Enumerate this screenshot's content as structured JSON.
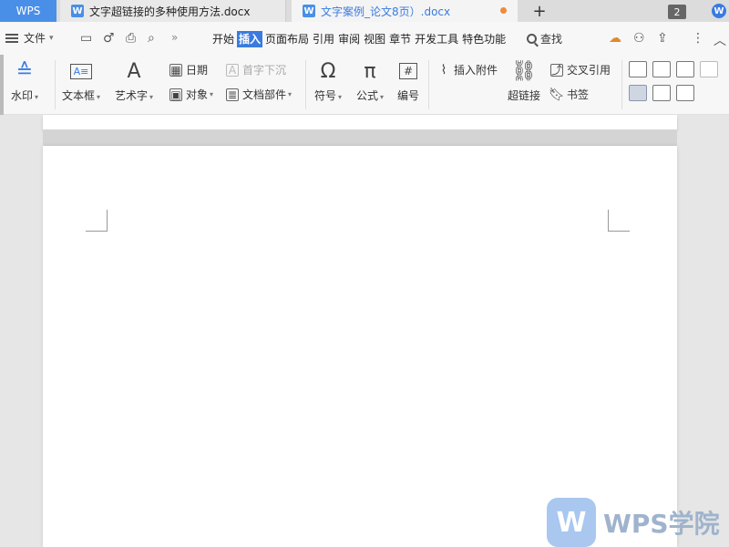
{
  "tabs": {
    "app_label": "WPS",
    "doc1_title": "文字超链接的多种使用方法.docx",
    "doc2_title": "文字案例_论文8页）.docx",
    "new_tab": "+",
    "window_count": "2"
  },
  "menu": {
    "file_label": "文件",
    "items": [
      "开始",
      "插入",
      "页面布局",
      "引用",
      "审阅",
      "视图",
      "章节",
      "开发工具",
      "特色功能"
    ],
    "active_index": 1,
    "search_label": "查找"
  },
  "ribbon": {
    "watermark": "水印",
    "textbox": "文本框",
    "wordart": "艺术字",
    "date": "日期",
    "drop_cap": "首字下沉",
    "object": "对象",
    "doc_parts": "文档部件",
    "symbol": "符号",
    "formula": "公式",
    "numbering": "编号",
    "attachment": "插入附件",
    "hyperlink": "超链接",
    "cross_ref": "交叉引用",
    "bookmark": "书签"
  },
  "watermark_logo": {
    "text": "WPS学院"
  },
  "colors": {
    "accent": "#3a7be0",
    "unsaved_dot": "#f08a3c"
  }
}
